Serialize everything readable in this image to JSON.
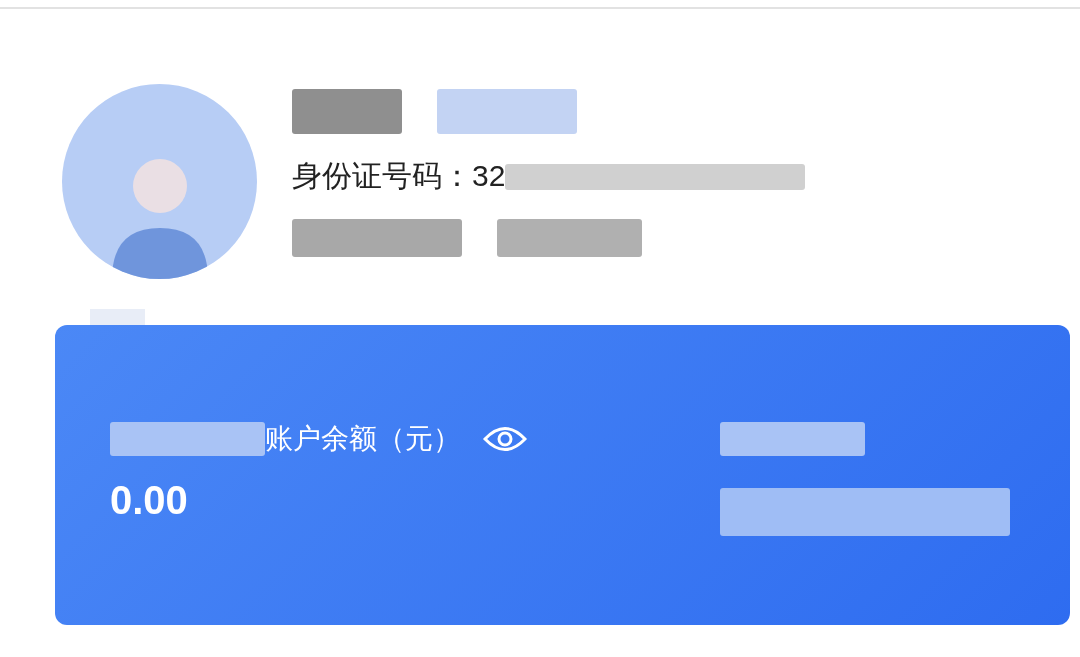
{
  "profile": {
    "id_number": "身份证号码：32"
  },
  "balance_card": {
    "label": "账户余额（元）",
    "amount": "0.00"
  }
}
